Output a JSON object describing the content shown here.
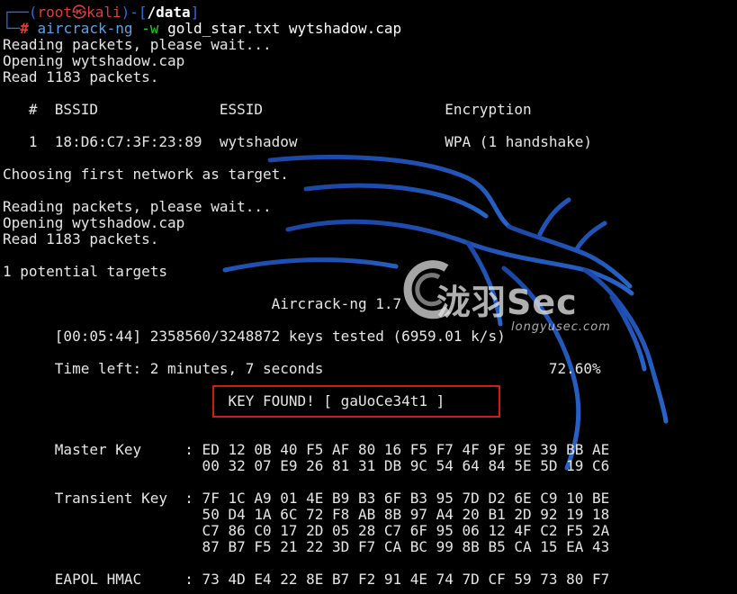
{
  "prompt": {
    "corner_top": "┌──(",
    "user": "root",
    "skull": "㉿",
    "host": "kali",
    "sep": ")-[",
    "cwd": "/data",
    "close": "]",
    "corner_bottom": "└─",
    "hash": "#",
    "command": "aircrack-ng",
    "flag": "-w",
    "args": "gold_star.txt wytshadow.cap"
  },
  "output": {
    "l1": "Reading packets, please wait...",
    "l2": "Opening wytshadow.cap",
    "l3": "Read 1183 packets.",
    "table_header": "   #  BSSID              ESSID                     Encryption",
    "table_row": "   1  18:D6:C7:3F:23:89  wytshadow                 WPA (1 handshake)",
    "choosing": "Choosing first network as target.",
    "l4": "Reading packets, please wait...",
    "l5": "Opening wytshadow.cap",
    "l6": "Read 1183 packets.",
    "targets": "1 potential targets",
    "banner": "                               Aircrack-ng 1.7",
    "progress": "      [00:05:44] 2358560/3248872 keys tested (6959.01 k/s)",
    "time_left": "      Time left: 2 minutes, 7 seconds                          72.60%",
    "key_found": "                          KEY FOUND! [ gaUoCe34t1 ]",
    "master1": "      Master Key     : ED 12 0B 40 F5 AF 80 16 F5 F7 4F 9F 9E 39 BB AE",
    "master2": "                       00 32 07 E9 26 81 31 DB 9C 54 64 84 5E 5D 19 C6",
    "trans1": "      Transient Key  : 7F 1C A9 01 4E B9 B3 6F B3 95 7D D2 6E C9 10 BE",
    "trans2": "                       50 D4 1A 6C 72 F8 AB 8B 97 A4 20 B1 2D 92 19 18",
    "trans3": "                       C7 86 C0 17 2D 05 28 C7 6F 95 06 12 4F C2 F5 2A",
    "trans4": "                       87 B7 F5 21 22 3D F7 CA BC 99 8B B5 CA 15 EA 43",
    "eapol": "      EAPOL HMAC     : 73 4D E4 22 8E B7 F2 91 4E 74 7D CF 59 73 80 F7"
  },
  "watermark": {
    "brand": "泷羽Sec",
    "url": "longyusec.com"
  },
  "colors": {
    "background": "#000000",
    "prompt_blue": "#2f6cd8",
    "prompt_red": "#e03c3c",
    "command_cyan": "#5ba3e6",
    "flag_green": "#34c734",
    "key_box": "#d21a1a"
  },
  "icons": {
    "dragon": "kali-dragon-icon",
    "logo": "longyusec-logo-icon"
  }
}
